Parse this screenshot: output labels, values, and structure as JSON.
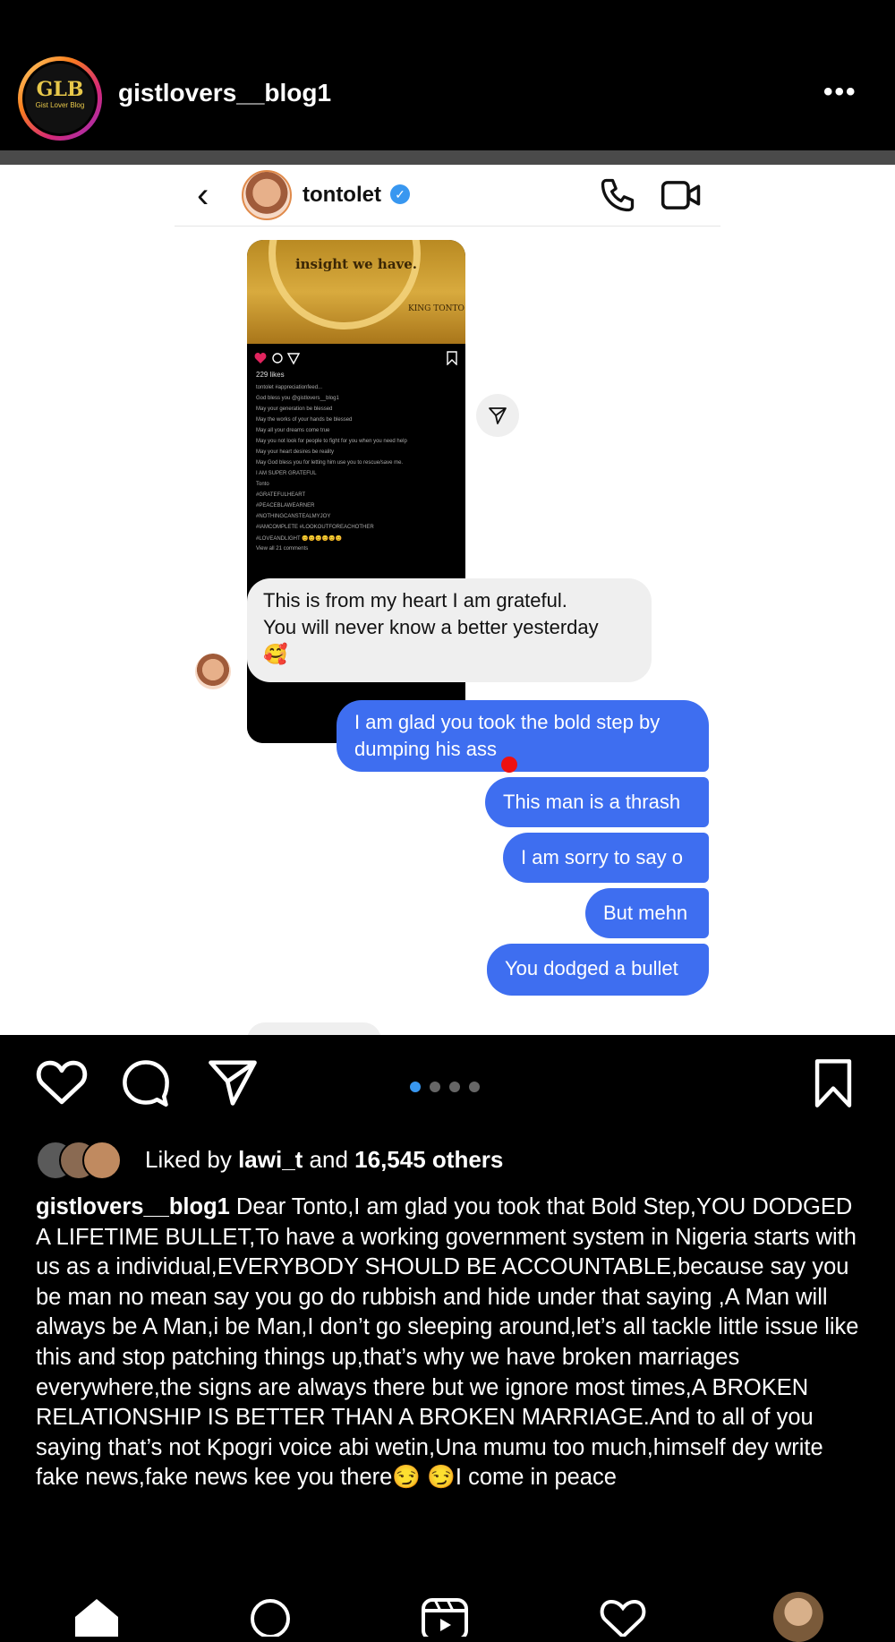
{
  "post": {
    "username": "gistlovers__blog1",
    "avatar_text": "GLB",
    "avatar_sub": "Gist Lover Blog",
    "more_label": "•••"
  },
  "dm": {
    "back_glyph": "‹",
    "name": "tontolet",
    "verified_glyph": "✓",
    "shared_post": {
      "caption": "insight we have.",
      "logo": "KING TONTO",
      "likes": "229 likes",
      "lines": [
        "tontolet #appreciationfeed...",
        "God bless you @gistlovers__blog1",
        "May your generation be blessed",
        "May the works of your hands be blessed",
        "May all your dreams come true",
        "May you not look for people to fight for you when you need help",
        "May your heart desires be reality",
        "May God bless you for letting him use you to rescue/save me.",
        "I AM SUPER GRATEFUL",
        "Tonto",
        "#GRATEFULHEART",
        "#PEACEBLAWEARNER",
        "#NOTHINGCANSTEALMYJOY",
        "#IAMCOMPLETE #LOOKOUTFOREACHOTHER",
        "#LOVEANDLIGHT 😊😊😊😊😊😊",
        "View all 21 comments"
      ]
    },
    "incoming": {
      "line1": "This is from my heart I am grateful.",
      "line2": "You will never know a better yesterday",
      "emoji": "🥰"
    },
    "outgoing": [
      "I am glad you took the bold step by dumping his ass",
      "This man is a thrash",
      "I am sorry to say o",
      "But mehn",
      "You dodged a bullet"
    ]
  },
  "actions": {
    "liked_prefix": "Liked by ",
    "liked_user": "lawi_t",
    "liked_middle": " and ",
    "liked_count": "16,545 others",
    "carousel_dots": 4,
    "carousel_active": 0
  },
  "caption": {
    "user": "gistlovers__blog1",
    "text": " Dear Tonto,I am glad you took that Bold Step,YOU DODGED A LIFETIME BULLET,To have  a working government system in Nigeria starts with us as a individual,EVERYBODY SHOULD BE ACCOUNTABLE,because say you be man no mean say you go do rubbish and hide under that saying ,A Man will always be A Man,i be Man,I don’t go sleeping around,let’s all tackle little issue like this and stop patching things up,that’s why we have broken marriages everywhere,the signs are always there but we ignore most times,A BROKEN RELATIONSHIP IS BETTER THAN A BROKEN MARRIAGE.And to all of you saying that’s not Kpogri voice abi wetin,Una mumu too much,himself dey write fake news,fake news kee you there😏 😏I come in peace"
  },
  "colors": {
    "outgoing_bubble": "#3e6ef0",
    "incoming_bubble": "#efefef",
    "verified": "#3897f0",
    "carousel_active": "#3897f0"
  }
}
